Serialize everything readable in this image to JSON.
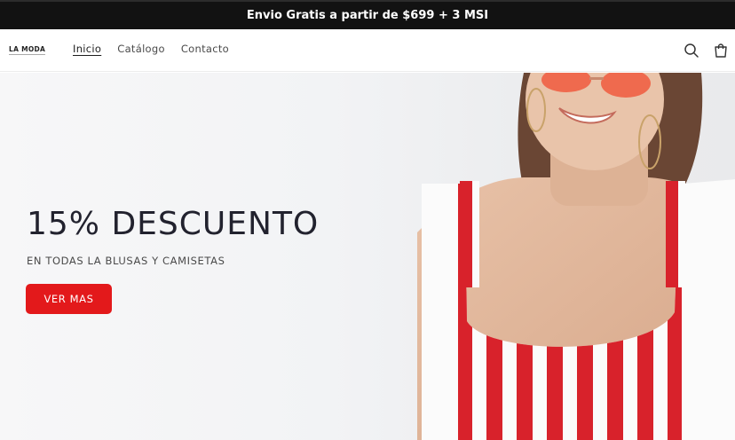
{
  "announcement": {
    "text": "Envio Gratis a partir de $699 + 3 MSI"
  },
  "header": {
    "logo": "LA MODA",
    "nav": [
      {
        "label": "Inicio",
        "active": true
      },
      {
        "label": "Catálogo",
        "active": false
      },
      {
        "label": "Contacto",
        "active": false
      }
    ],
    "icons": [
      "search-icon",
      "cart-icon"
    ]
  },
  "hero": {
    "title": "15% DESCUENTO",
    "subtitle": "EN TODAS LA BLUSAS Y CAMISETAS",
    "button_label": "VER MAS"
  },
  "colors": {
    "announcement_bg": "#121212",
    "accent": "#e3191b",
    "title_text": "#22222e"
  }
}
